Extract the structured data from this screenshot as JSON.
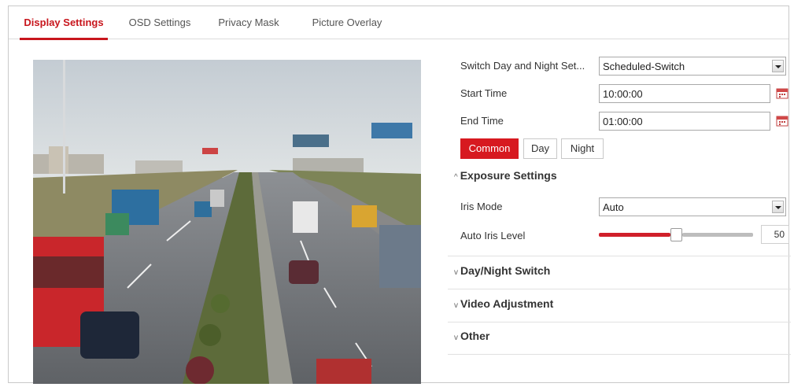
{
  "tabs": [
    {
      "label": "Display Settings",
      "active": true
    },
    {
      "label": "OSD Settings",
      "active": false
    },
    {
      "label": "Privacy Mask",
      "active": false
    },
    {
      "label": "Picture Overlay",
      "active": false
    }
  ],
  "video": {
    "description_icon": "camera-live-view"
  },
  "settings": {
    "switch_day_night": {
      "label": "Switch Day and Night Set...",
      "value": "Scheduled-Switch"
    },
    "start_time": {
      "label": "Start Time",
      "value": "10:00:00"
    },
    "end_time": {
      "label": "End Time",
      "value": "01:00:00"
    },
    "modes": [
      {
        "label": "Common",
        "active": true
      },
      {
        "label": "Day",
        "active": false
      },
      {
        "label": "Night",
        "active": false
      }
    ]
  },
  "sections": {
    "exposure": {
      "title": "Exposure Settings",
      "chevron": "^",
      "expanded": true
    },
    "day_night": {
      "title": "Day/Night Switch",
      "chevron": "v",
      "expanded": false
    },
    "video_adjust": {
      "title": "Video Adjustment",
      "chevron": "v",
      "expanded": false
    },
    "other": {
      "title": "Other",
      "chevron": "v",
      "expanded": false
    }
  },
  "exposure": {
    "iris_mode": {
      "label": "Iris Mode",
      "value": "Auto"
    },
    "auto_iris_level": {
      "label": "Auto Iris Level",
      "value": "50",
      "fraction": 0.5
    }
  },
  "colors": {
    "accent": "#d71920",
    "tab_active": "#c8161d"
  }
}
